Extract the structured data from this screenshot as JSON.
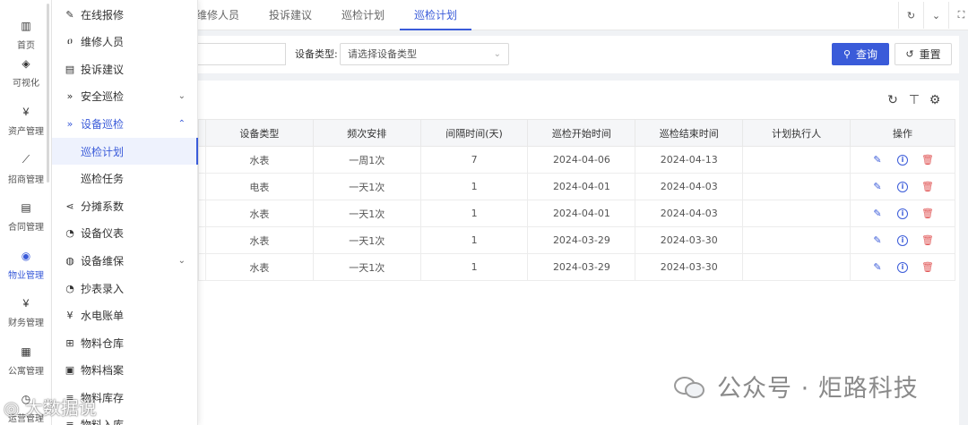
{
  "rail": {
    "items": [
      {
        "icon": "bank-icon",
        "glyph": "🏛",
        "label": "首页"
      },
      {
        "icon": "visualize-icon",
        "glyph": "◈",
        "label": "可视化"
      },
      {
        "icon": "asset-icon",
        "glyph": "¥",
        "label": "资产管理"
      },
      {
        "icon": "trend-icon",
        "glyph": "📈",
        "label": "招商管理"
      },
      {
        "icon": "contract-icon",
        "glyph": "📋",
        "label": "合同管理"
      },
      {
        "icon": "property-icon",
        "glyph": "◉",
        "label": "物业管理"
      },
      {
        "icon": "finance-icon",
        "glyph": "¥",
        "label": "财务管理"
      },
      {
        "icon": "apartment-icon",
        "glyph": "▦",
        "label": "公寓管理"
      },
      {
        "icon": "operation-icon",
        "glyph": "◷",
        "label": "运营管理"
      }
    ],
    "active_index": 5
  },
  "submenu": {
    "items": [
      {
        "label": "在线报修",
        "glyph": "🔧"
      },
      {
        "label": "维修人员",
        "glyph": "👤"
      },
      {
        "label": "投诉建议",
        "glyph": "▤"
      },
      {
        "label": "安全巡检",
        "glyph": "»",
        "chevron": "⌄"
      },
      {
        "label": "设备巡检",
        "glyph": "»",
        "chevron": "⌃"
      },
      {
        "label": "巡检计划",
        "glyph": ""
      },
      {
        "label": "巡检任务",
        "glyph": ""
      },
      {
        "label": "分摊系数",
        "glyph": "⋖"
      },
      {
        "label": "设备仪表",
        "glyph": "◔"
      },
      {
        "label": "设备维保",
        "glyph": "◍",
        "chevron": "⌄"
      },
      {
        "label": "抄表录入",
        "glyph": "◔"
      },
      {
        "label": "水电账单",
        "glyph": "¥"
      },
      {
        "label": "物料仓库",
        "glyph": "⊞"
      },
      {
        "label": "物料档案",
        "glyph": "▣"
      },
      {
        "label": "物料库存",
        "glyph": "≡"
      },
      {
        "label": "物料入库",
        "glyph": "≡"
      }
    ]
  },
  "tabs": {
    "items": [
      "维修人员",
      "投诉建议",
      "巡检计划",
      "巡检计划"
    ],
    "active_index": 3
  },
  "search": {
    "type_label": "设备类型:",
    "type_placeholder": "请选择设备类型",
    "query_label": "查询",
    "reset_label": "重置"
  },
  "table": {
    "columns": [
      "设备类型",
      "频次安排",
      "间隔时间(天)",
      "巡检开始时间",
      "巡检结束时间",
      "计划执行人",
      "操作"
    ],
    "rows": [
      [
        "水表",
        "一周1次",
        "7",
        "2024-04-06",
        "2024-04-13",
        ""
      ],
      [
        "电表",
        "一天1次",
        "1",
        "2024-04-01",
        "2024-04-03",
        ""
      ],
      [
        "水表",
        "一天1次",
        "1",
        "2024-04-01",
        "2024-04-03",
        ""
      ],
      [
        "水表",
        "一天1次",
        "1",
        "2024-03-29",
        "2024-03-30",
        ""
      ],
      [
        "水表",
        "一天1次",
        "1",
        "2024-03-29",
        "2024-03-30",
        ""
      ]
    ]
  },
  "watermark": {
    "text": "公众号 · 炬路科技",
    "corner": "大数据说"
  },
  "colors": {
    "accent": "#3a5bd9",
    "danger": "#e05555"
  }
}
